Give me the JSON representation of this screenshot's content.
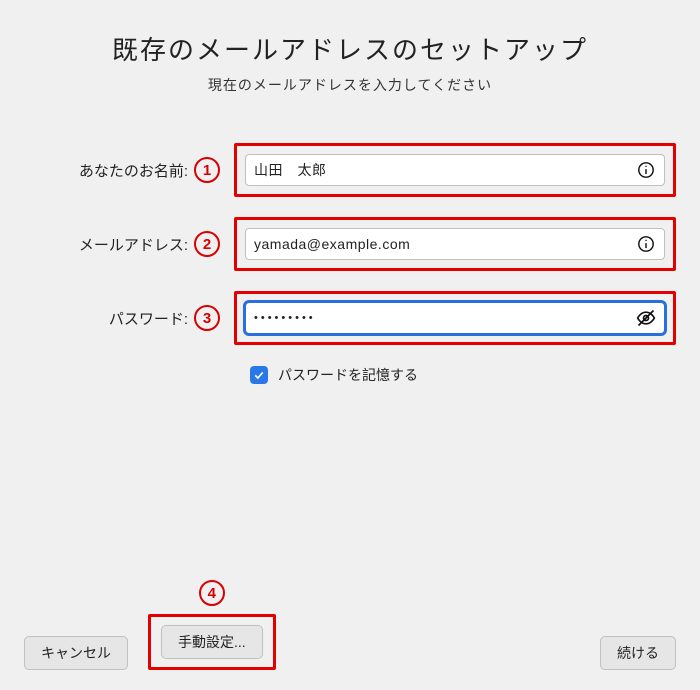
{
  "header": {
    "title": "既存のメールアドレスのセットアップ",
    "subtitle": "現在のメールアドレスを入力してください"
  },
  "fields": {
    "name": {
      "label": "あなたのお名前:",
      "badge": "1",
      "value": "山田　太郎"
    },
    "email": {
      "label": "メールアドレス:",
      "badge": "2",
      "value": "yamada@example.com"
    },
    "password": {
      "label": "パスワード:",
      "badge": "3",
      "value": "•••••••••"
    }
  },
  "remember": {
    "label": "パスワードを記憶する",
    "checked": true
  },
  "buttons": {
    "cancel": "キャンセル",
    "manual": "手動設定...",
    "manual_badge": "4",
    "continue": "続ける"
  }
}
